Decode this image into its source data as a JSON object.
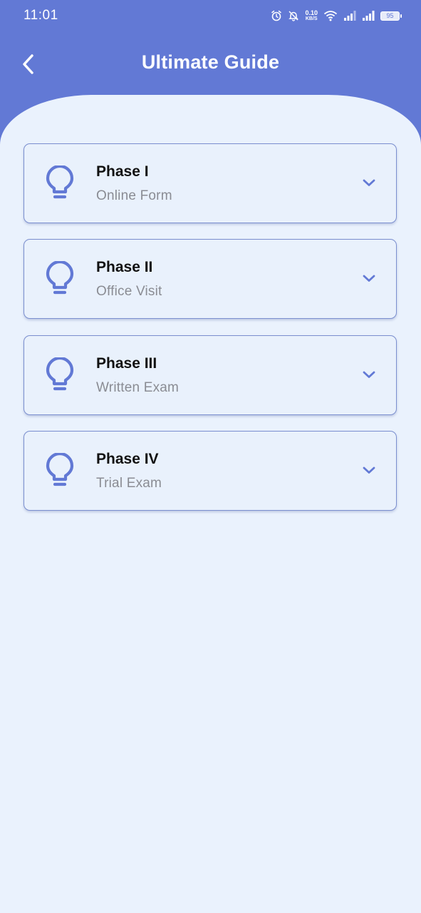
{
  "status_bar": {
    "time": "11:01",
    "net_speed_value": "0.10",
    "net_speed_unit": "KB/S",
    "battery": "95"
  },
  "header": {
    "title": "Ultimate Guide",
    "back_icon": "chevron-left-icon"
  },
  "colors": {
    "primary": "#6279d5",
    "background": "#eaf2fd",
    "card_border": "#7b8fcf",
    "subtitle": "#8a8c93"
  },
  "phases": [
    {
      "title": "Phase I",
      "subtitle": "Online Form",
      "icon": "lightbulb-icon"
    },
    {
      "title": "Phase II",
      "subtitle": "Office Visit",
      "icon": "lightbulb-icon"
    },
    {
      "title": "Phase III",
      "subtitle": "Written Exam",
      "icon": "lightbulb-icon"
    },
    {
      "title": "Phase IV",
      "subtitle": "Trial Exam",
      "icon": "lightbulb-icon"
    }
  ]
}
